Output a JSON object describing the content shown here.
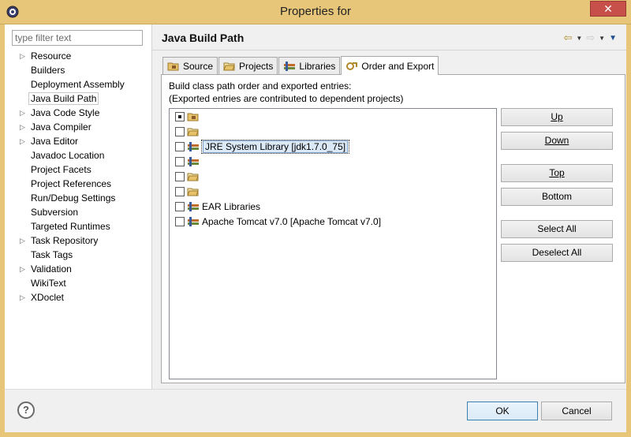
{
  "window": {
    "title": "Properties for"
  },
  "filter": {
    "placeholder": "type filter text"
  },
  "tree": [
    {
      "label": "Resource",
      "expandable": true
    },
    {
      "label": "Builders",
      "expandable": false
    },
    {
      "label": "Deployment Assembly",
      "expandable": false
    },
    {
      "label": "Java Build Path",
      "expandable": false,
      "selected": true
    },
    {
      "label": "Java Code Style",
      "expandable": true
    },
    {
      "label": "Java Compiler",
      "expandable": true
    },
    {
      "label": "Java Editor",
      "expandable": true
    },
    {
      "label": "Javadoc Location",
      "expandable": false
    },
    {
      "label": "Project Facets",
      "expandable": false
    },
    {
      "label": "Project References",
      "expandable": false
    },
    {
      "label": "Run/Debug Settings",
      "expandable": false
    },
    {
      "label": "Subversion",
      "expandable": false
    },
    {
      "label": "Targeted Runtimes",
      "expandable": false
    },
    {
      "label": "Task Repository",
      "expandable": true
    },
    {
      "label": "Task Tags",
      "expandable": false
    },
    {
      "label": "Validation",
      "expandable": true
    },
    {
      "label": "WikiText",
      "expandable": false
    },
    {
      "label": "XDoclet",
      "expandable": true
    }
  ],
  "page": {
    "title": "Java Build Path"
  },
  "tabs": [
    {
      "label": "Source",
      "icon": "source-folder-icon",
      "active": false
    },
    {
      "label": "Projects",
      "icon": "projects-icon",
      "active": false
    },
    {
      "label": "Libraries",
      "icon": "libraries-icon",
      "active": false
    },
    {
      "label": "Order and Export",
      "icon": "order-export-icon",
      "active": true
    }
  ],
  "order_export": {
    "description_line1": "Build class path order and exported entries:",
    "description_line2": "(Exported entries are contributed to dependent projects)",
    "entries": [
      {
        "label": "",
        "icon": "source-folder-icon",
        "checked": "partial"
      },
      {
        "label": "",
        "icon": "folder-icon",
        "checked": false
      },
      {
        "label": "JRE System Library [jdk1.7.0_75]",
        "icon": "library-icon",
        "checked": false,
        "highlighted": true
      },
      {
        "label": "",
        "icon": "library-icon",
        "checked": false
      },
      {
        "label": "",
        "icon": "folder-icon",
        "checked": false
      },
      {
        "label": "",
        "icon": "folder-icon",
        "checked": false
      },
      {
        "label": "EAR Libraries",
        "icon": "library-icon",
        "checked": false
      },
      {
        "label": "Apache Tomcat v7.0 [Apache Tomcat v7.0]",
        "icon": "library-icon",
        "checked": false
      }
    ],
    "buttons": {
      "up": "Up",
      "down": "Down",
      "top": "Top",
      "bottom": "Bottom",
      "select_all": "Select All",
      "deselect_all": "Deselect All"
    }
  },
  "footer": {
    "ok": "OK",
    "cancel": "Cancel",
    "help_glyph": "?"
  }
}
